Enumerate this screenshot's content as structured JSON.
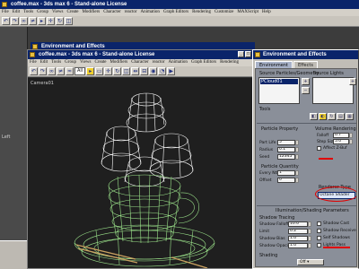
{
  "back_window": {
    "title": "coffee.max - 3ds max 6 - Stand-alone License",
    "menu": [
      "File",
      "Edit",
      "Tools",
      "Group",
      "Views",
      "Create",
      "Modifiers",
      "Character",
      "reactor",
      "Animation",
      "Graph Editors",
      "Rendering",
      "Customize",
      "MAXScript",
      "Help"
    ],
    "left_label": "Left",
    "env_title": "Environment and Effects"
  },
  "front_window": {
    "title": "coffee.max - 3ds max 6 - Stand-alone License",
    "menu": [
      "File",
      "Edit",
      "Tools",
      "Group",
      "Views",
      "Create",
      "Modifiers",
      "Character",
      "reactor",
      "Animation",
      "Graph Editors",
      "Rendering"
    ],
    "toolbar_dropdown": "All",
    "viewport_label": "Camera01"
  },
  "env_dialog": {
    "title": "Environment and Effects",
    "tabs": [
      "Environment",
      "Effects"
    ],
    "source_particles_label": "Source Particles/Geometry",
    "particle_item": "PCloud01",
    "source_lights_label": "Source Lights",
    "tools_label": "Tools",
    "particle_property": "Particle Property",
    "volume_rendering": "Volume Rendering",
    "falloff_label": "Falloff",
    "falloff_value": "0.7",
    "step_size_label": "Step Size",
    "step_size_value": "5.0",
    "affect_zbuf": "Affect Z-Buf",
    "part_life_label": "Part Life",
    "part_life_value": "5",
    "radius_label": "Radius",
    "radius_value": "0.1",
    "seed_label": "Seed",
    "seed_value": "12345",
    "particle_quantity": "Particle Quantity",
    "every_nth_label": "Every Nth",
    "every_nth_value": "1",
    "offset_label": "Offset",
    "offset_value": "0",
    "renderer_type_label": "Renderer Type",
    "renderer_type_value": "Octane Shader",
    "illumination_header": "Illumination/Shading Parameters",
    "shadow_tracing": "Shadow Tracing",
    "shadow_falloff_label": "Shadow Falloff",
    "shadow_falloff_value": "10.0",
    "shadow_limit_label": "Limit",
    "shadow_limit_value": "0.2",
    "shadow_bias_label": "Shadow Bias",
    "shadow_bias_value": "1.0",
    "shadow_opacity_label": "Shadow Opacity",
    "shadow_opacity_value": "1.0",
    "shadow_cast": "Shadow Cast",
    "shadow_receive": "Shadow Receive",
    "self_shadows": "Self Shadows",
    "lights_pass": "Lights Pass",
    "shading_label": "Shading",
    "shading_value": "Off"
  },
  "colors": {
    "title_blue": "#0a246a",
    "panel_gray": "#8a8f99",
    "wire_white": "#ffffff",
    "wire_green": "#9be28a",
    "spoon_tan": "#c8a060",
    "highlight_red": "#e00000"
  }
}
